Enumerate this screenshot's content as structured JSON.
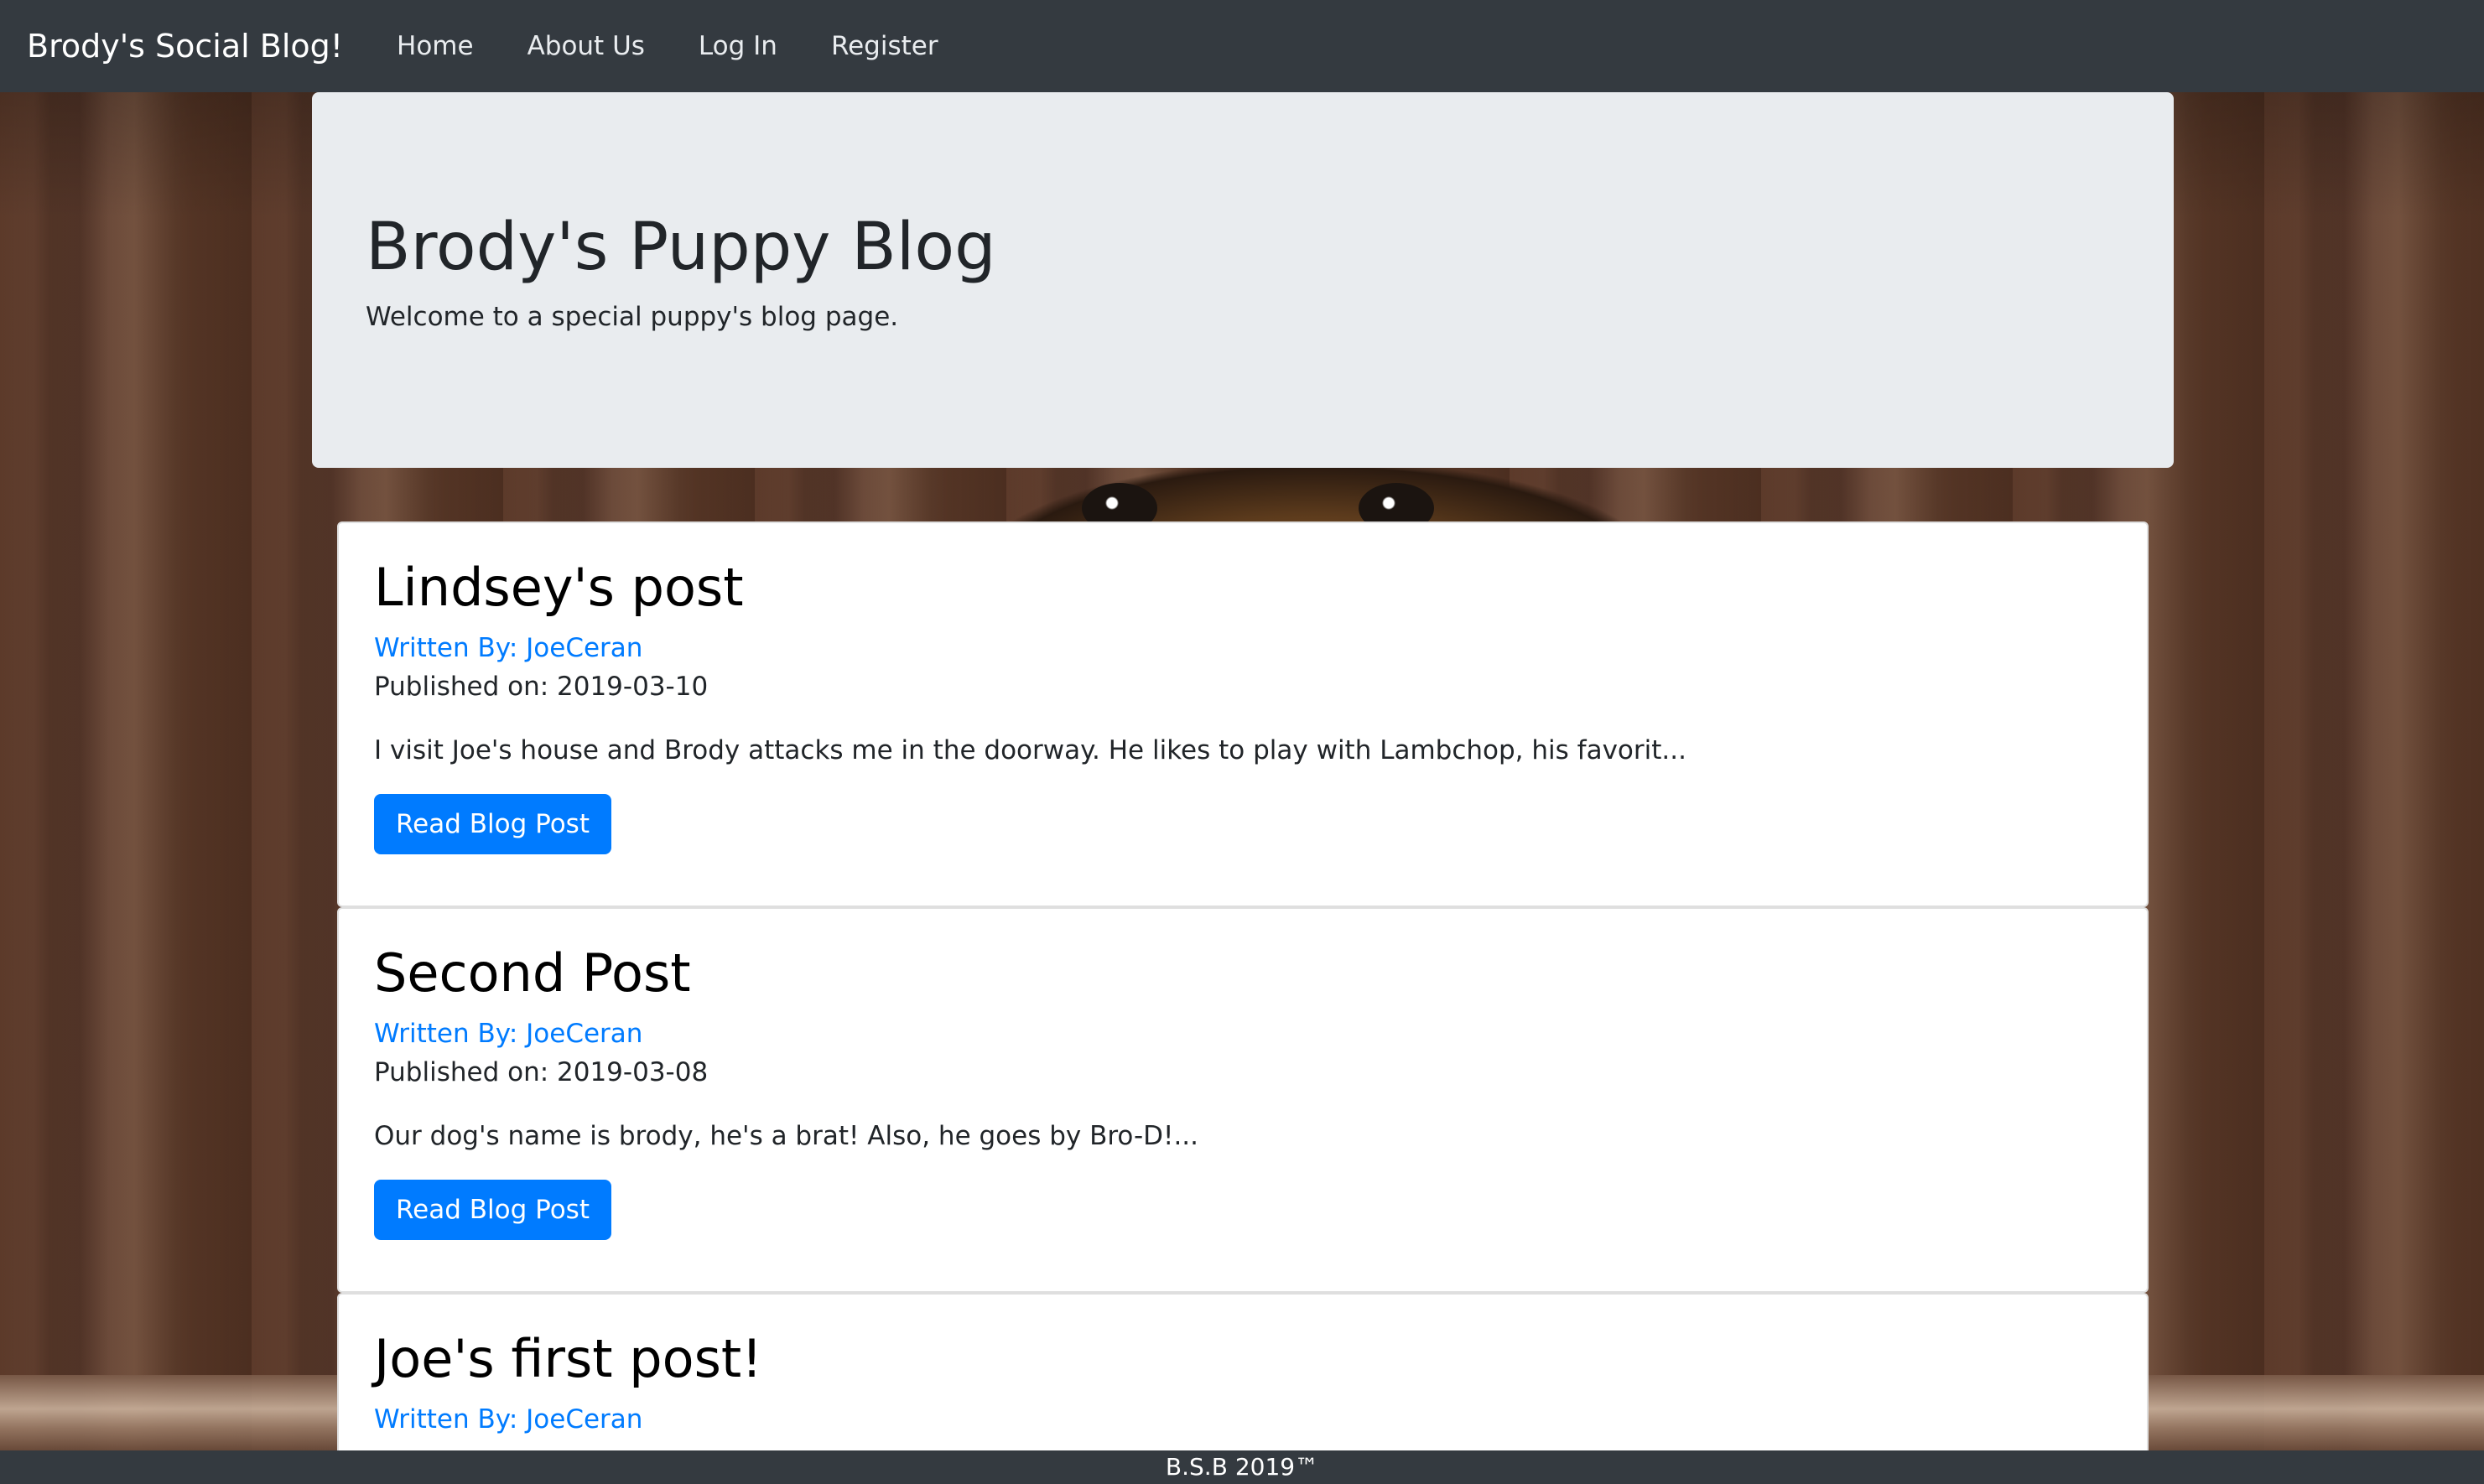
{
  "navbar": {
    "brand": "Brody's Social Blog!",
    "links": [
      "Home",
      "About Us",
      "Log In",
      "Register"
    ]
  },
  "jumbotron": {
    "title": "Brody's Puppy Blog",
    "subtitle": "Welcome to a special puppy's blog page."
  },
  "posts": [
    {
      "title": "Lindsey's post",
      "author": "Written By: JoeCeran",
      "published": "Published on: 2019-03-10",
      "excerpt": "I visit Joe's house and Brody attacks me in the doorway. He likes to play with Lambchop, his favorit...",
      "button": "Read Blog Post"
    },
    {
      "title": "Second Post",
      "author": "Written By: JoeCeran",
      "published": "Published on: 2019-03-08",
      "excerpt": "Our dog's name is brody, he's a brat! Also, he goes by Bro-D!...",
      "button": "Read Blog Post"
    },
    {
      "title": "Joe's first post!",
      "author": "Written By: JoeCeran"
    }
  ],
  "footer": {
    "text": "B.S.B 2019™"
  },
  "colors": {
    "navbar": "#343a40",
    "jumbotron": "#e9ecef",
    "link": "#007bff",
    "button": "#007bff"
  }
}
